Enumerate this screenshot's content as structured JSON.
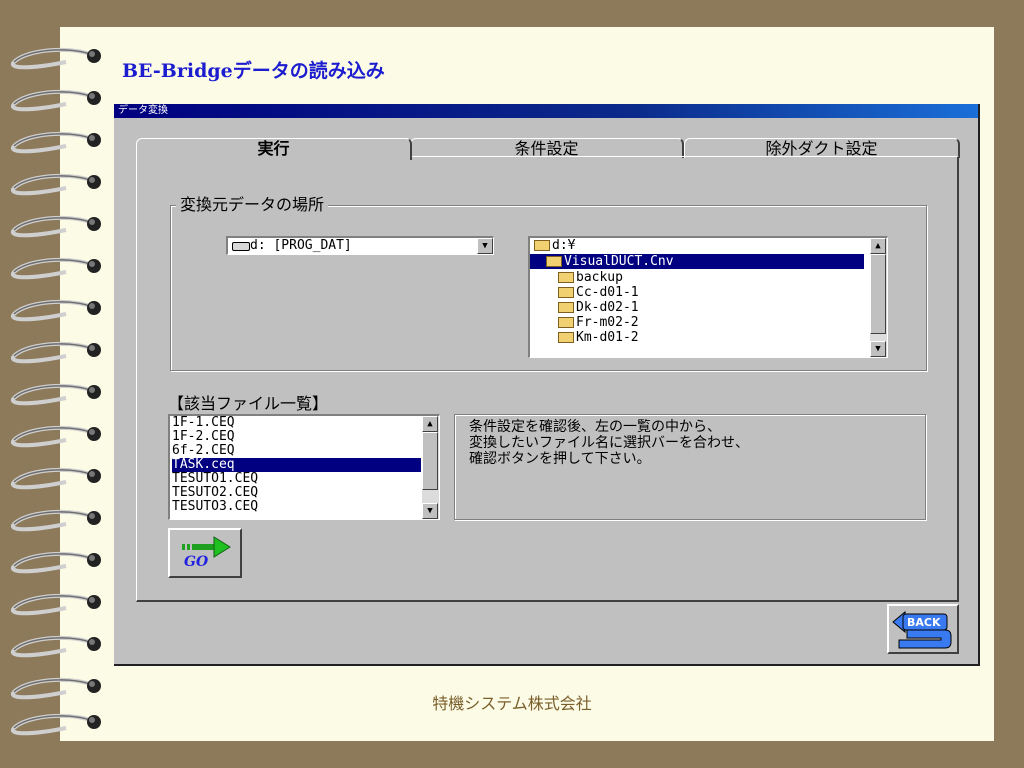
{
  "slide": {
    "title": "BE-Bridgeデータの読み込み",
    "footer": "特機システム株式会社"
  },
  "window": {
    "title": "データ変換",
    "tabs": [
      "実行",
      "条件設定",
      "除外ダクト設定"
    ],
    "active_tab": "実行"
  },
  "source_group": {
    "label": "変換元データの場所",
    "drive": "d: [PROG_DAT]",
    "folders": [
      "d:¥",
      "VisualDUCT.Cnv",
      "backup",
      "Cc-d01-1",
      "Dk-d02-1",
      "Fr-m02-2",
      "Km-d01-2"
    ],
    "selected_folder": "VisualDUCT.Cnv"
  },
  "files": {
    "label": "【該当ファイル一覧】",
    "items": [
      "1F-1.CEQ",
      "1F-2.CEQ",
      "6f-2.CEQ",
      "TASK.ceq",
      "TESUTO1.CEQ",
      "TESUTO2.CEQ",
      "TESUTO3.CEQ"
    ],
    "selected": "TASK.ceq"
  },
  "instructions": [
    "条件設定を確認後、左の一覧の中から、",
    "変換したいファイル名に選択バーを合わせ、",
    "確認ボタンを押して下さい。"
  ],
  "buttons": {
    "go": "GO",
    "back": "BACK"
  },
  "colors": {
    "background": "#8c7a5b",
    "paper": "#fbfbe6",
    "title": "#1d1dd0",
    "selection": "#000080"
  }
}
